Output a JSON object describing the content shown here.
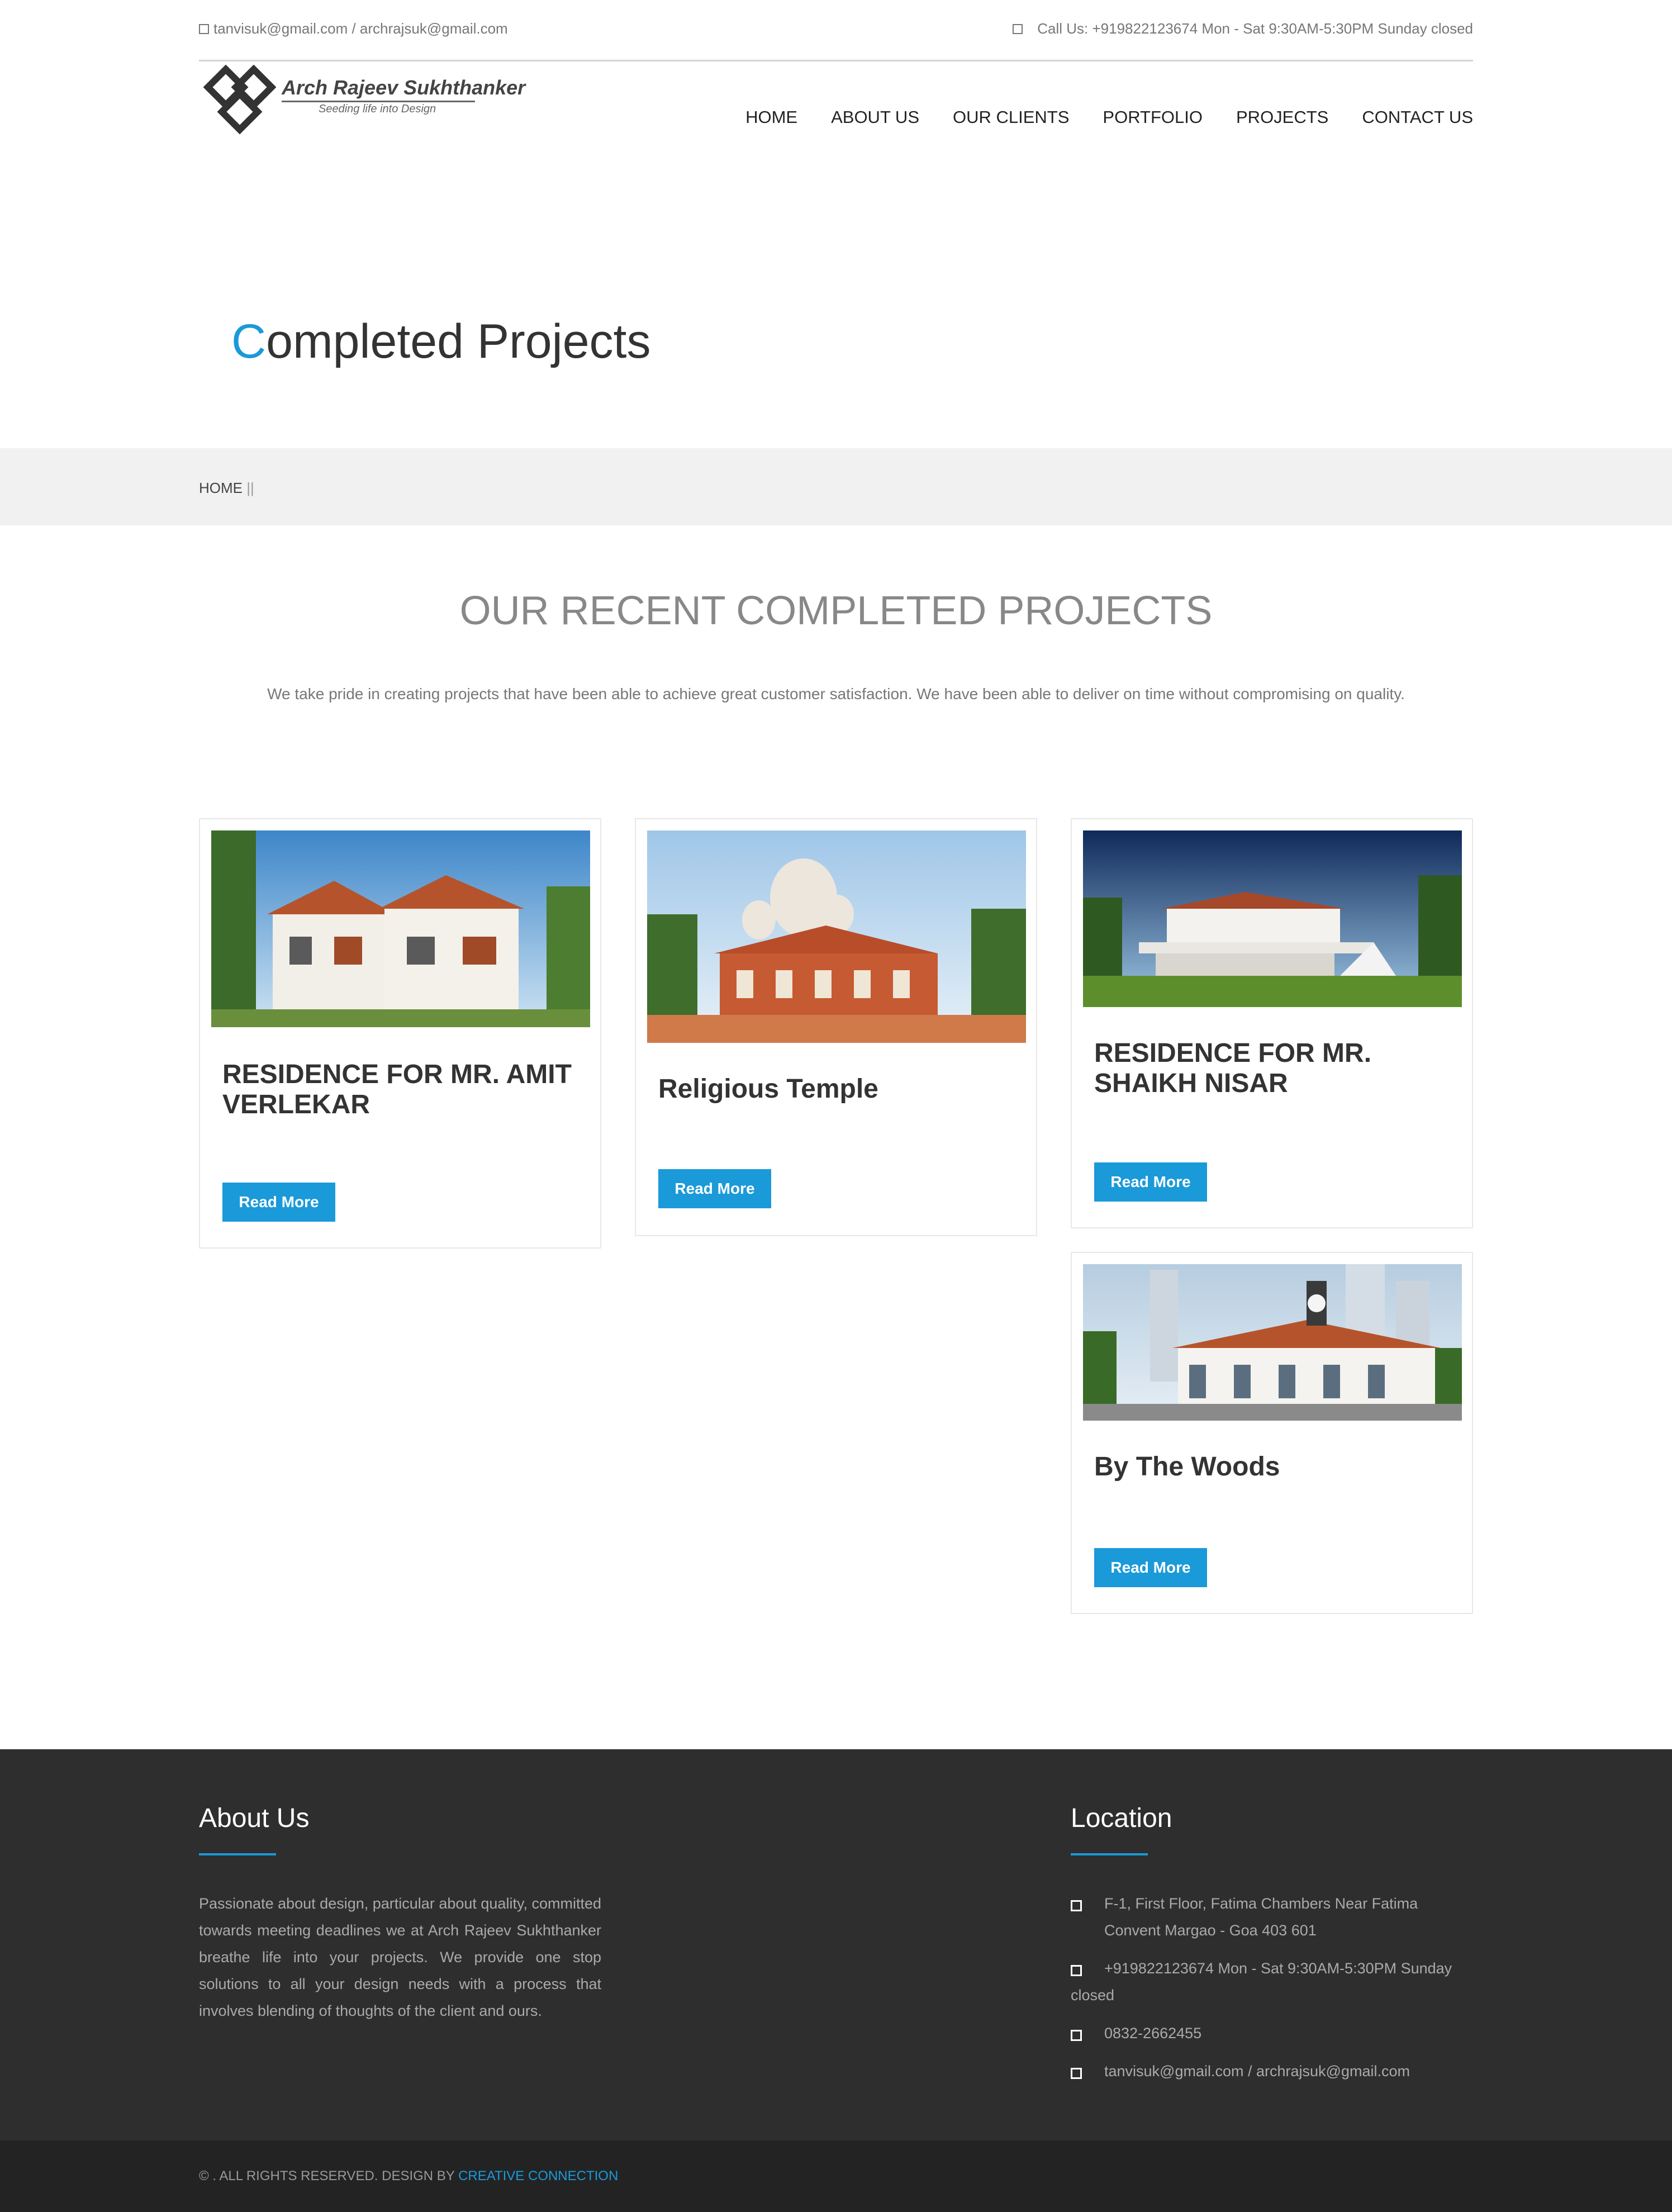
{
  "topbar": {
    "email": "tanvisuk@gmail.com / archrajsuk@gmail.com",
    "phone": "Call Us: +919822123674 Mon - Sat 9:30AM-5:30PM Sunday closed"
  },
  "logo": {
    "name": "Arch Rajeev Sukhthanker",
    "tagline": "Seeding life into Design"
  },
  "nav": {
    "items": [
      "HOME",
      "ABOUT US",
      "OUR CLIENTS",
      "PORTFOLIO",
      "PROJECTS",
      "CONTACT US"
    ]
  },
  "page": {
    "title_first": "C",
    "title_rest": "ompleted Projects"
  },
  "breadcrumb": {
    "home": "HOME",
    "sep": "||"
  },
  "section": {
    "heading": "OUR RECENT COMPLETED PROJECTS",
    "subtitle": "We take pride in creating projects that have been able to achieve great customer satisfaction. We have been able to deliver on time without compromising on quality."
  },
  "projects": [
    {
      "title": "RESIDENCE FOR MR. AMIT VERLEKAR",
      "button": "Read More"
    },
    {
      "title": "Religious Temple",
      "button": "Read More"
    },
    {
      "title": "RESIDENCE FOR MR. SHAIKH NISAR",
      "button": "Read More"
    },
    {
      "title": "By The Woods",
      "button": "Read More"
    }
  ],
  "footer": {
    "about_heading": "About Us",
    "about_text": "Passionate about design, particular about quality, committed towards meeting deadlines we at Arch Rajeev Sukhthanker breathe life into your projects. We provide one stop solutions to all your design needs with a process that involves blending of thoughts of the client and ours.",
    "location_heading": "Location",
    "address": "F-1, First Floor, Fatima Chambers Near Fatima Convent Margao - Goa 403 601",
    "phone": "+919822123674 Mon - Sat 9:30AM-5:30PM Sunday closed",
    "landline": "0832-2662455",
    "emails": "tanvisuk@gmail.com / archrajsuk@gmail.com"
  },
  "bottom": {
    "copyright": "© . ALL RIGHTS RESERVED. DESIGN BY ",
    "designer": "CREATIVE CONNECTION"
  },
  "colors": {
    "accent": "#1a9ad9",
    "footer_bg": "#2e2e2f",
    "bottom_bg": "#232324"
  }
}
